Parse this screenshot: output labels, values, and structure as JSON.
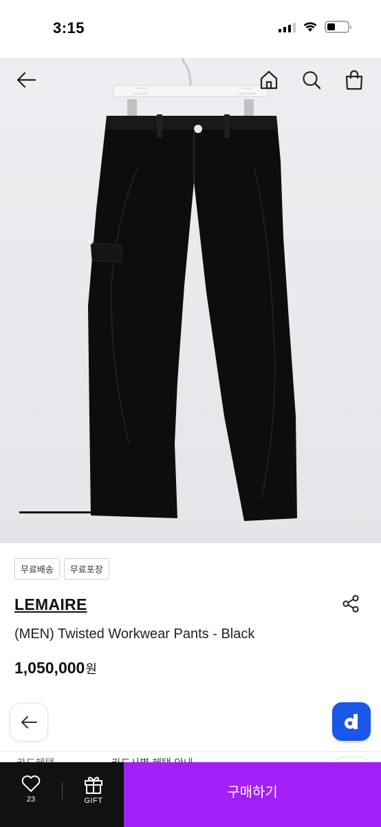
{
  "status_bar": {
    "time": "3:15"
  },
  "header": {
    "back_icon": "arrow-left-icon",
    "home_icon": "home-icon",
    "search_icon": "search-icon",
    "cart_icon": "shopping-bag-icon"
  },
  "hero": {
    "image": "product-photo-black-pants-on-hanger"
  },
  "product": {
    "badges": [
      "무료배송",
      "무료포장"
    ],
    "brand": "LEMAIRE",
    "name": "(MEN) Twisted Workwear Pants - Black",
    "price": "1,050,000",
    "currency": "원"
  },
  "floating": {
    "back_icon": "arrow-left-icon",
    "app_icon": "d-logo-icon"
  },
  "info_row": {
    "left": "카드혜택",
    "right": "카드사별 혜택 안내"
  },
  "bottom_bar": {
    "like_count": "23",
    "gift_label": "GIFT",
    "buy_label": "구매하기"
  },
  "colors": {
    "buy_button": "#a21ff5",
    "bottom_left": "#111111",
    "app_button": "#1a57e8"
  }
}
